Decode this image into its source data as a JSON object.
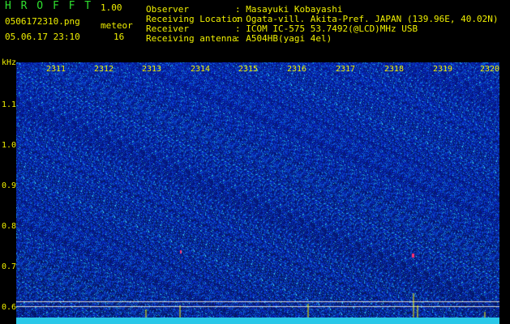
{
  "header": {
    "app_title": "H R O F F T",
    "version": "1.00",
    "filename": "0506172310.png",
    "datetime": "05.06.17 23:10",
    "meteor_label": "meteor",
    "meteor_count": "16",
    "info": [
      {
        "label": "Observer",
        "value": ": Masayuki Kobayashi"
      },
      {
        "label": "Receiving Location",
        "value": ": Ogata-vill. Akita-Pref. JAPAN (139.96E, 40.02N)"
      },
      {
        "label": "Receiver",
        "value": ": ICOM IC-575 53.7492(@LCD)MHz USB"
      },
      {
        "label": "Receiving antenna",
        "value": ": A504HB(yagi 4el)"
      }
    ]
  },
  "chart_data": {
    "type": "heatmap",
    "ylabel": "kHz",
    "y_ticks": [
      "1.1",
      "1.0",
      "0.9",
      "0.8",
      "0.7",
      "0.6"
    ],
    "x_ticks": [
      "2311",
      "2312",
      "2313",
      "2314",
      "2315",
      "2316",
      "2317",
      "2318",
      "2319",
      "2320"
    ],
    "colors": {
      "background": "#000000",
      "low": "#0a1a8a",
      "mid": "#1f4fd0",
      "high": "#39e0f0",
      "meteor": "#ffff00"
    }
  }
}
